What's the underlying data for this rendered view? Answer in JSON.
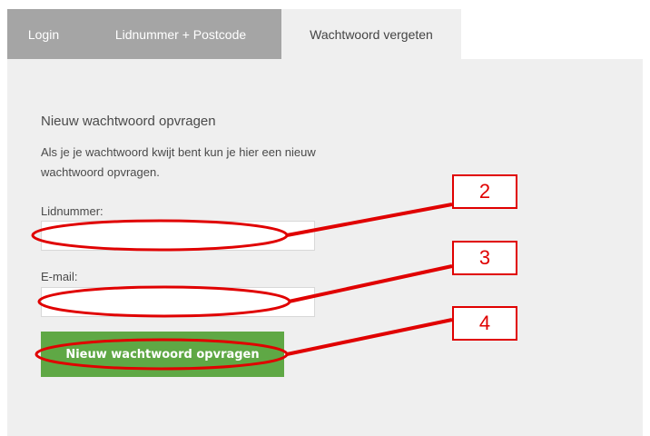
{
  "tabs": {
    "login": "Login",
    "lidnummer_postcode": "Lidnummer + Postcode",
    "wachtwoord_vergeten": "Wachtwoord vergeten"
  },
  "form": {
    "heading": "Nieuw wachtwoord opvragen",
    "intro_line1": "Als je je wachtwoord kwijt bent kun je hier een nieuw",
    "intro_line2": "wachtwoord opvragen.",
    "lidnummer_label": "Lidnummer:",
    "lidnummer_value": "",
    "email_label": "E-mail:",
    "email_value": "",
    "submit_label": "Nieuw wachtwoord opvragen"
  },
  "annotations": {
    "callout_2": "2",
    "callout_3": "3",
    "callout_4": "4",
    "color": "#e00000"
  },
  "colors": {
    "tab_inactive": "#a5a5a5",
    "panel_bg": "#efefef",
    "button_green": "#5fa845"
  }
}
